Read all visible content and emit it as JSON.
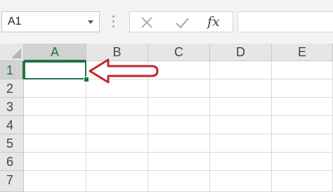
{
  "name_box": {
    "value": "A1"
  },
  "formula_bar": {
    "cancel_icon": "close-icon",
    "enter_icon": "checkmark-icon",
    "function_label": "fx",
    "formula_value": ""
  },
  "grid": {
    "columns": [
      "A",
      "B",
      "C",
      "D",
      "E"
    ],
    "rows": [
      "1",
      "2",
      "3",
      "4",
      "5",
      "6",
      "7"
    ],
    "active_cell": "A1",
    "active_column": "A",
    "active_row": "1"
  },
  "annotation": {
    "icon": "arrow-left-icon",
    "color": "#c0282c"
  },
  "colors": {
    "selection": "#217346",
    "header_bg": "#e6e6e6",
    "gridline": "#d9d9d9"
  }
}
